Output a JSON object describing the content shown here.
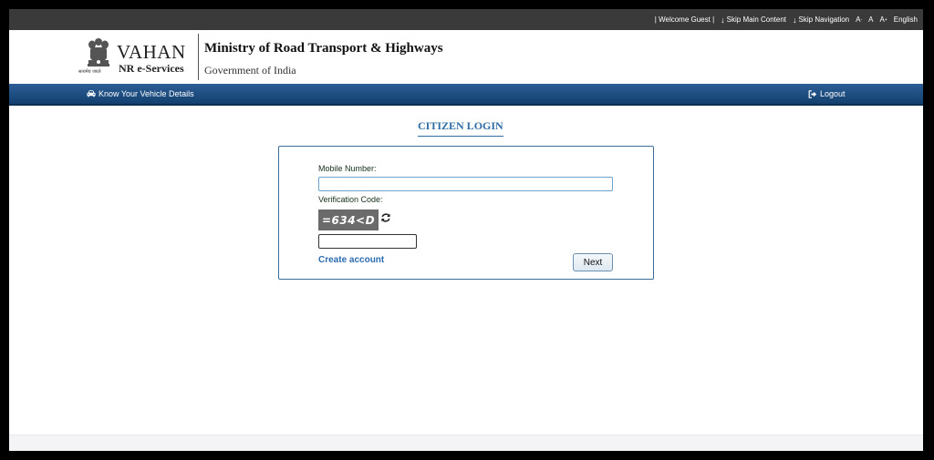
{
  "topbar": {
    "welcome": "| Welcome Guest |",
    "skip_main": "Skip Main Content",
    "skip_nav": "Skip Navigation",
    "font_decrease": "A",
    "font_normal": "A",
    "font_increase": "A",
    "language": "English"
  },
  "header": {
    "emblem_caption": "सत्यमेव जयते",
    "brand": "VAHAN",
    "brand_sub": "NR e-Services",
    "ministry": "Ministry of Road Transport & Highways",
    "government": "Government of India"
  },
  "nav": {
    "know_vehicle": "Know Your Vehicle Details",
    "logout": "Logout"
  },
  "login": {
    "title": "CITIZEN LOGIN",
    "mobile_label": "Mobile Number:",
    "mobile_value": "",
    "verification_label": "Verification Code:",
    "captcha_text": "=634<D",
    "captcha_value": "",
    "create_account": "Create account",
    "next_label": "Next"
  },
  "colors": {
    "navbar": "#1d4e83",
    "topbar": "#3a3a3a",
    "title": "#2e6ca5",
    "link": "#2c6cb0"
  }
}
